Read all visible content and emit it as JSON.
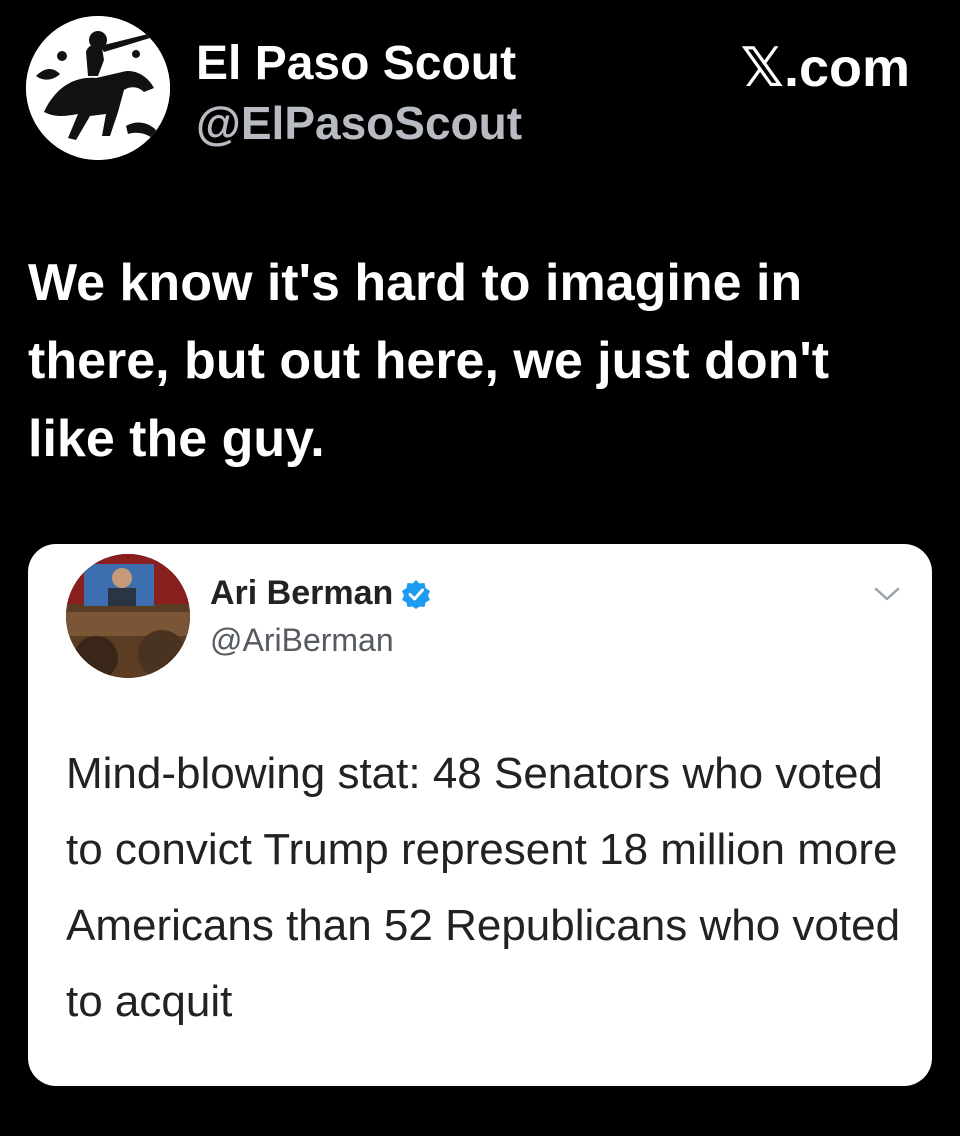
{
  "tweet": {
    "author_name": "El Paso Scout",
    "author_handle": "@ElPasoScout",
    "site_label": "𝕏.com",
    "text": "We know it's hard to imagine in there, but out here, we just don't like the guy."
  },
  "quoted_tweet": {
    "author_name": "Ari Berman",
    "author_handle": "@AriBerman",
    "text": "Mind-blowing stat: 48 Senators who voted to convict Trump represent 18 million more Americans than 52 Republicans who voted to acquit",
    "verified_badge_icon": "verified-badge-icon",
    "menu_icon": "chevron-down-icon"
  },
  "colors": {
    "background": "#000000",
    "handle_gray": "#b8bcc2",
    "card_background": "#ffffff",
    "verified_blue": "#1d9bf0"
  }
}
